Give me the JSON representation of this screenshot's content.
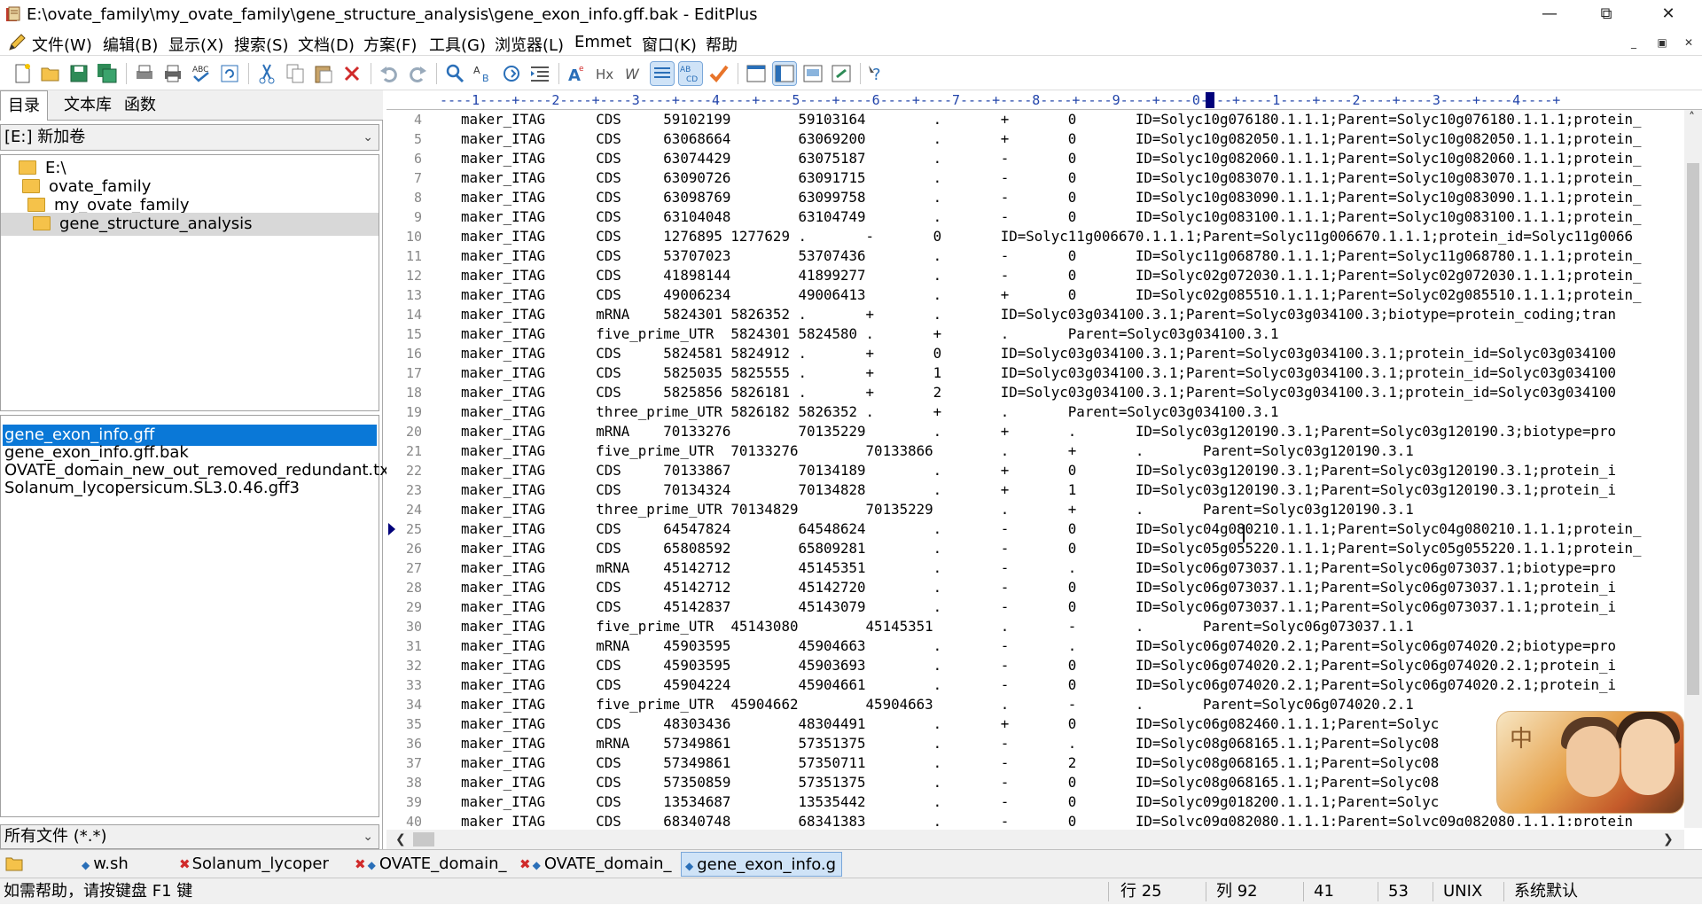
{
  "window": {
    "title": "E:\\ovate_family\\my_ovate_family\\gene_structure_analysis\\gene_exon_info.gff.bak - EditPlus"
  },
  "menu": {
    "items": [
      "文件(W)",
      "编辑(B)",
      "显示(X)",
      "搜索(S)",
      "文档(D)",
      "方案(F)",
      "工具(G)",
      "浏览器(L)",
      "Emmet",
      "窗口(K)",
      "帮助"
    ]
  },
  "toolbar": {
    "icons": [
      "new-file-icon",
      "open-icon",
      "save-icon",
      "save-all-icon",
      "print-preview-icon",
      "print-icon",
      "spellcheck-icon",
      "refresh-icon",
      "cut-icon",
      "copy-icon",
      "paste-icon",
      "delete-icon",
      "undo-icon",
      "redo-icon",
      "find-icon",
      "replace-icon",
      "goto-icon",
      "indent-icon",
      "font-icon",
      "heading-icon",
      "wordwrap-icon",
      "line-numbers-icon",
      "abc-icon",
      "check-icon",
      "view1-icon",
      "view2-icon",
      "view3-icon",
      "view4-icon",
      "help-icon"
    ]
  },
  "left": {
    "tabs": [
      "目录",
      "文本库",
      "函数"
    ],
    "drive": "[E:] 新加卷",
    "tree": [
      "E:\\",
      "ovate_family",
      "my_ovate_family",
      "gene_structure_analysis"
    ],
    "files": [
      "gene_exon_info.gff",
      "gene_exon_info.gff.bak",
      "OVATE_domain_new_out_removed_redundant.txt",
      "Solanum_lycopersicum.SL3.0.46.gff3"
    ],
    "filter": "所有文件 (*.*)"
  },
  "editor": {
    "ruler": "----1----+----2----+----3----+----4----+----5----+----6----+----7----+----8----+----9----+----0----+----1----+----2----+----3----+----4----+",
    "lines": [
      {
        "n": "4",
        "t": "    maker_ITAG      CDS     59102199        59103164        .       +       0       ID=Solyc10g076180.1.1.1;Parent=Solyc10g076180.1.1.1;protein_"
      },
      {
        "n": "5",
        "t": "    maker_ITAG      CDS     63068664        63069200        .       +       0       ID=Solyc10g082050.1.1.1;Parent=Solyc10g082050.1.1.1;protein_"
      },
      {
        "n": "6",
        "t": "    maker_ITAG      CDS     63074429        63075187        .       -       0       ID=Solyc10g082060.1.1.1;Parent=Solyc10g082060.1.1.1;protein_"
      },
      {
        "n": "7",
        "t": "    maker_ITAG      CDS     63090726        63091715        .       -       0       ID=Solyc10g083070.1.1.1;Parent=Solyc10g083070.1.1.1;protein_"
      },
      {
        "n": "8",
        "t": "    maker_ITAG      CDS     63098769        63099758        .       -       0       ID=Solyc10g083090.1.1.1;Parent=Solyc10g083090.1.1.1;protein_"
      },
      {
        "n": "9",
        "t": "    maker_ITAG      CDS     63104048        63104749        .       -       0       ID=Solyc10g083100.1.1.1;Parent=Solyc10g083100.1.1.1;protein_"
      },
      {
        "n": "10",
        "t": "    maker_ITAG      CDS     1276895 1277629 .       -       0       ID=Solyc11g006670.1.1.1;Parent=Solyc11g006670.1.1.1;protein_id=Solyc11g0066"
      },
      {
        "n": "11",
        "t": "    maker_ITAG      CDS     53707023        53707436        .       -       0       ID=Solyc11g068780.1.1.1;Parent=Solyc11g068780.1.1.1;protein_"
      },
      {
        "n": "12",
        "t": "    maker_ITAG      CDS     41898144        41899277        .       -       0       ID=Solyc02g072030.1.1.1;Parent=Solyc02g072030.1.1.1;protein_"
      },
      {
        "n": "13",
        "t": "    maker_ITAG      CDS     49006234        49006413        .       +       0       ID=Solyc02g085510.1.1.1;Parent=Solyc02g085510.1.1.1;protein_"
      },
      {
        "n": "14",
        "t": "    maker_ITAG      mRNA    5824301 5826352 .       +       .       ID=Solyc03g034100.3.1;Parent=Solyc03g034100.3;biotype=protein_coding;tran"
      },
      {
        "n": "15",
        "t": "    maker_ITAG      five_prime_UTR  5824301 5824580 .       +       .       Parent=Solyc03g034100.3.1"
      },
      {
        "n": "16",
        "t": "    maker_ITAG      CDS     5824581 5824912 .       +       0       ID=Solyc03g034100.3.1;Parent=Solyc03g034100.3.1;protein_id=Solyc03g034100"
      },
      {
        "n": "17",
        "t": "    maker_ITAG      CDS     5825035 5825555 .       +       1       ID=Solyc03g034100.3.1;Parent=Solyc03g034100.3.1;protein_id=Solyc03g034100"
      },
      {
        "n": "18",
        "t": "    maker_ITAG      CDS     5825856 5826181 .       +       2       ID=Solyc03g034100.3.1;Parent=Solyc03g034100.3.1;protein_id=Solyc03g034100"
      },
      {
        "n": "19",
        "t": "    maker_ITAG      three_prime_UTR 5826182 5826352 .       +       .       Parent=Solyc03g034100.3.1"
      },
      {
        "n": "20",
        "t": "    maker_ITAG      mRNA    70133276        70135229        .       +       .       ID=Solyc03g120190.3.1;Parent=Solyc03g120190.3;biotype=pro"
      },
      {
        "n": "21",
        "t": "    maker_ITAG      five_prime_UTR  70133276        70133866        .       +       .       Parent=Solyc03g120190.3.1"
      },
      {
        "n": "22",
        "t": "    maker_ITAG      CDS     70133867        70134189        .       +       0       ID=Solyc03g120190.3.1;Parent=Solyc03g120190.3.1;protein_i"
      },
      {
        "n": "23",
        "t": "    maker_ITAG      CDS     70134324        70134828        .       +       1       ID=Solyc03g120190.3.1;Parent=Solyc03g120190.3.1;protein_i"
      },
      {
        "n": "24",
        "t": "    maker_ITAG      three_prime_UTR 70134829        70135229        .       +       .       Parent=Solyc03g120190.3.1"
      },
      {
        "n": "25",
        "t": "    maker_ITAG      CDS     64547824        64548624        .       -       0       ID=Solyc04g080210.1.1.1;Parent=Solyc04g080210.1.1.1;protein_"
      },
      {
        "n": "26",
        "t": "    maker_ITAG      CDS     65808592        65809281        .       -       0       ID=Solyc05g055220.1.1.1;Parent=Solyc05g055220.1.1.1;protein_"
      },
      {
        "n": "27",
        "t": "    maker_ITAG      mRNA    45142712        45145351        .       -       .       ID=Solyc06g073037.1.1;Parent=Solyc06g073037.1;biotype=pro"
      },
      {
        "n": "28",
        "t": "    maker_ITAG      CDS     45142712        45142720        .       -       0       ID=Solyc06g073037.1.1;Parent=Solyc06g073037.1.1;protein_i"
      },
      {
        "n": "29",
        "t": "    maker_ITAG      CDS     45142837        45143079        .       -       0       ID=Solyc06g073037.1.1;Parent=Solyc06g073037.1.1;protein_i"
      },
      {
        "n": "30",
        "t": "    maker_ITAG      five_prime_UTR  45143080        45145351        .       -       .       Parent=Solyc06g073037.1.1"
      },
      {
        "n": "31",
        "t": "    maker_ITAG      mRNA    45903595        45904663        .       -       .       ID=Solyc06g074020.2.1;Parent=Solyc06g074020.2;biotype=pro"
      },
      {
        "n": "32",
        "t": "    maker_ITAG      CDS     45903595        45903693        .       -       0       ID=Solyc06g074020.2.1;Parent=Solyc06g074020.2.1;protein_i"
      },
      {
        "n": "33",
        "t": "    maker_ITAG      CDS     45904224        45904661        .       -       0       ID=Solyc06g074020.2.1;Parent=Solyc06g074020.2.1;protein_i"
      },
      {
        "n": "34",
        "t": "    maker_ITAG      five_prime_UTR  45904662        45904663        .       -       .       Parent=Solyc06g074020.2.1"
      },
      {
        "n": "35",
        "t": "    maker_ITAG      CDS     48303436        48304491        .       +       0       ID=Solyc06g082460.1.1.1;Parent=Solyc"
      },
      {
        "n": "36",
        "t": "    maker_ITAG      mRNA    57349861        57351375        .       -       .       ID=Solyc08g068165.1.1;Parent=Solyc08"
      },
      {
        "n": "37",
        "t": "    maker_ITAG      CDS     57349861        57350711        .       -       2       ID=Solyc08g068165.1.1;Parent=Solyc08"
      },
      {
        "n": "38",
        "t": "    maker_ITAG      CDS     57350859        57351375        .       -       0       ID=Solyc08g068165.1.1;Parent=Solyc08"
      },
      {
        "n": "39",
        "t": "    maker_ITAG      CDS     13534687        13535442        .       -       0       ID=Solyc09g018200.1.1.1;Parent=Solyc"
      },
      {
        "n": "40",
        "t": "    maker_ITAG      CDS     68340748        68341383        .       -       0       ID=Solyc09g082080.1.1.1;Parent=Solyc09g082080.1.1.1;protein_"
      }
    ]
  },
  "doctabs": [
    "w.sh",
    "Solanum_lycoper",
    "OVATE_domain_",
    "OVATE_domain_",
    "gene_exon_info.g"
  ],
  "status": {
    "help": "如需帮助，请按键盘 F1 键",
    "row": "行 25",
    "col": "列 92",
    "a": "41",
    "b": "53",
    "eol": "UNIX",
    "enc": "系统默认"
  },
  "ime": {
    "label": "中"
  },
  "colors": {
    "accent": "#0a78d7",
    "ruler": "#2244aa",
    "selected_tab": "#cfe3f7"
  }
}
